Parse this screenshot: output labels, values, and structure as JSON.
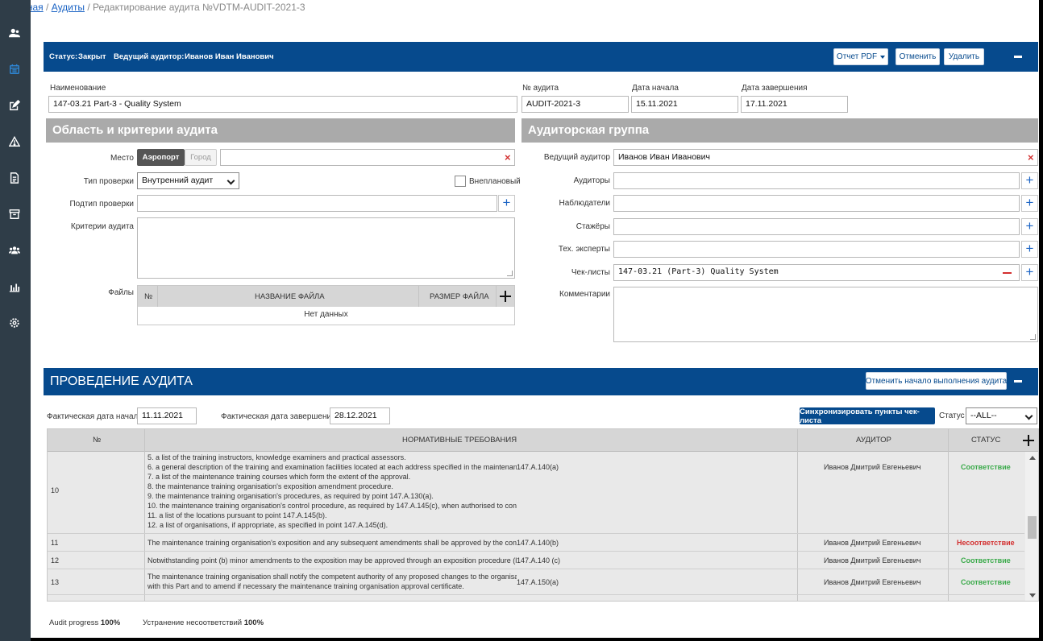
{
  "breadcrumb": {
    "home": "Главная",
    "audits": "Аудиты",
    "current": "Редактирование аудита №VDTM-AUDIT-2021-3"
  },
  "sidebar": {
    "icons": [
      "users-icon",
      "calendar-icon",
      "edit-icon",
      "warning-icon",
      "document-icon",
      "archive-icon",
      "group-icon",
      "bar-chart-icon",
      "gear-icon"
    ]
  },
  "topbar": {
    "status_label": "Статус:",
    "status_value": "Закрыт",
    "lead_label": "Ведущий аудитор:",
    "lead_value": "Иванов Иван Иванович",
    "pdf_button": "Отчет PDF",
    "cancel_button": "Отменить",
    "delete_button": "Удалить"
  },
  "form": {
    "name_label": "Наименование",
    "name_value": "147-03.21 Part-3 - Quality System",
    "audit_no_label": "№ аудита",
    "audit_no_value": "AUDIT-2021-3",
    "start_label": "Дата начала",
    "start_value": "15.11.2021",
    "end_label": "Дата завершения",
    "end_value": "17.11.2021"
  },
  "scope": {
    "title": "Область и критерии аудита",
    "place_label": "Место",
    "place_airport": "Аэропорт",
    "place_city": "Город",
    "type_label": "Тип проверки",
    "type_value": "Внутренний аудит",
    "unplanned_label": "Внеплановый",
    "subtype_label": "Подтип проверки",
    "criteria_label": "Критерии аудита",
    "files_label": "Файлы",
    "files_col_no": "№",
    "files_col_name": "НАЗВАНИЕ ФАЙЛА",
    "files_col_size": "РАЗМЕР ФАЙЛА",
    "files_empty": "Нет данных"
  },
  "team": {
    "title": "Аудиторская группа",
    "lead_label": "Ведущий аудитор",
    "lead_value": "Иванов Иван Иванович",
    "auditors_label": "Аудиторы",
    "observers_label": "Наблюдатели",
    "trainees_label": "Стажёры",
    "experts_label": "Тех. эксперты",
    "checklists_label": "Чек-листы",
    "checklist_value": "147-03.21 (Part-3) Quality System",
    "comments_label": "Комментарии"
  },
  "conduct": {
    "title": "ПРОВЕДЕНИЕ АУДИТА",
    "cancel_start_button": "Отменить начало выполнения аудита",
    "actual_start_label": "Фактическая дата начала",
    "actual_start_value": "11.11.2021",
    "actual_end_label": "Фактическая дата завершения",
    "actual_end_value": "28.12.2021",
    "sync_button": "Синхронизировать пункты чек-листа",
    "status_label": "Статус",
    "status_filter": "--ALL--",
    "columns": {
      "no": "№",
      "req": "НОРМАТИВНЫЕ ТРЕБОВАНИЯ",
      "auditor": "АУДИТОР",
      "status": "СТАТУС"
    },
    "row10_lines": [
      "5. a list of the training instructors, knowledge examiners and practical assessors.",
      "6. a general description of the training and examination facilities located at each address specified in the maintenance",
      "7. a list of the maintenance training courses which form the extent of the approval.",
      "8. the maintenance training organisation's exposition amendment procedure.",
      "9. the maintenance training organisation's procedures, as required by point 147.A.130(a).",
      "10. the maintenance training organisation's control procedure, as required by 147.A.145(c), when authorised to con",
      "11. a list of the locations pursuant to point 147.A.145(b).",
      "12. a list of organisations, if appropriate, as specified in point 147.A.145(d)."
    ],
    "rows": [
      {
        "no": "10",
        "ref": "147.A.140(a)",
        "auditor": "Иванов Дмитрий Евгеньевич",
        "status": "Соответствие"
      },
      {
        "no": "11",
        "text": "The maintenance training organisation's exposition and any subsequent amendments shall be approved by the con",
        "ref": "147.A.140(b)",
        "auditor": "Иванов Дмитрий Евгеньевич",
        "status": "Несоответствие"
      },
      {
        "no": "12",
        "text": "Notwithstanding point (b) minor amendments to the exposition may be approved through an exposition procedure (l",
        "ref": "147.A.140 (c)",
        "auditor": "Иванов Дмитрий Евгеньевич",
        "status": "Соответствие"
      },
      {
        "no": "13",
        "text": "The maintenance training organisation shall notify the competent authority of any proposed changes to the organisa",
        "text2": "with this Part and to amend if necessary the maintenance training organisation approval certificate.",
        "ref": "147.A.150(a)",
        "auditor": "Иванов Дмитрий Евгеньевич",
        "status": "Соответствие"
      }
    ],
    "progress_label": "Audit progress",
    "progress_value": "100%",
    "fix_label": "Устранение несоответствий",
    "fix_value": "100%"
  },
  "colors": {
    "brand": "#064a8d",
    "ok": "#3aaa4a",
    "bad": "#d32f2f",
    "sidebar": "#2f3d48"
  }
}
